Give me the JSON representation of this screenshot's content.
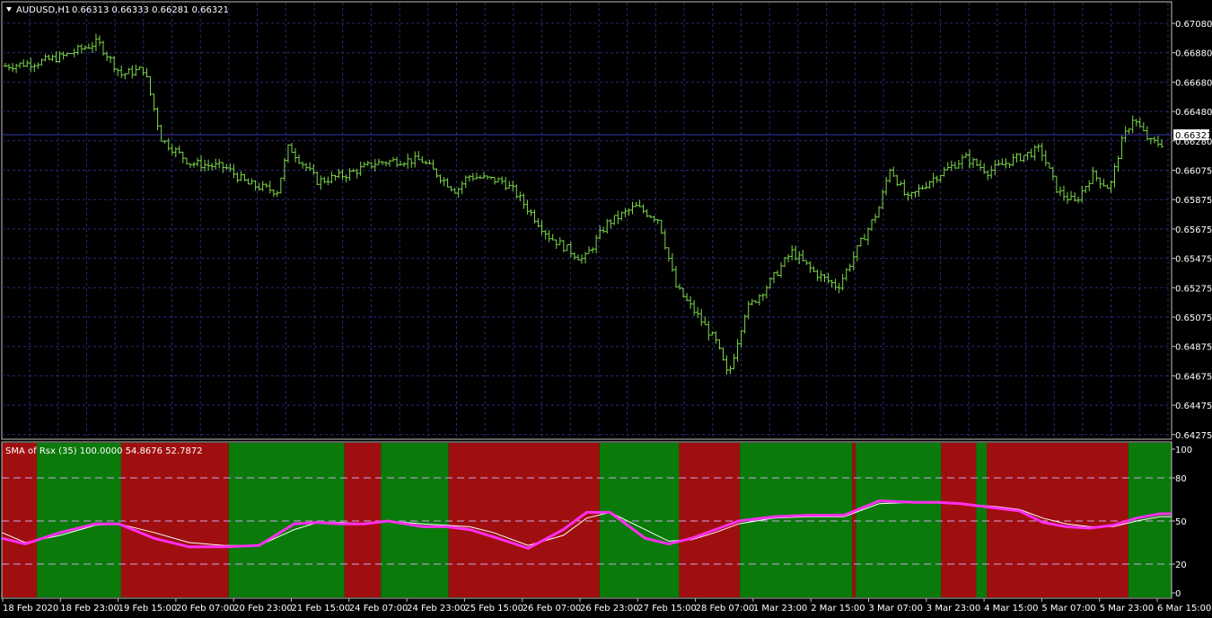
{
  "header": {
    "symbol_tf": "AUDUSD,H1",
    "ohlc": "0.66313 0.66333 0.66281 0.66321"
  },
  "indicator": {
    "label": "SMA  of Rsx (35) 100.0000 54.8676 52.7872"
  },
  "price_axis": {
    "ticks": [
      "0.67080",
      "0.66880",
      "0.66680",
      "0.66480",
      "0.66280",
      "0.66075",
      "0.65875",
      "0.65675",
      "0.65475",
      "0.65275",
      "0.65075",
      "0.64875",
      "0.64675",
      "0.64475",
      "0.64275"
    ],
    "current_price": "0.66321"
  },
  "indicator_axis": {
    "ticks": [
      "100",
      "80",
      "50",
      "20",
      "0"
    ]
  },
  "time_axis": {
    "ticks": [
      "18 Feb 2020",
      "18 Feb 23:00",
      "19 Feb 15:00",
      "20 Feb 07:00",
      "20 Feb 23:00",
      "21 Feb 15:00",
      "24 Feb 07:00",
      "24 Feb 23:00",
      "25 Feb 15:00",
      "26 Feb 07:00",
      "26 Feb 23:00",
      "27 Feb 15:00",
      "28 Feb 07:00",
      "1 Mar 23:00",
      "2 Mar 15:00",
      "3 Mar 07:00",
      "3 Mar 23:00",
      "4 Mar 15:00",
      "5 Mar 07:00",
      "5 Mar 23:00",
      "6 Mar 15:00"
    ]
  },
  "colors": {
    "background": "#000000",
    "grid": "#2a2a78",
    "bars": "#7cd84a",
    "axis_text": "#ffffff",
    "zone_bull": "#0a7a0a",
    "zone_bear": "#a00f0f",
    "rsx_line": "#ff2ef0",
    "signal_line": "#ffffff",
    "level_line": "#c9a8e8"
  },
  "chart_data": {
    "type": "line",
    "title": "AUDUSD,H1",
    "price_path": [
      [
        0,
        0.6687
      ],
      [
        0.03,
        0.669
      ],
      [
        0.05,
        0.6694
      ],
      [
        0.08,
        0.6704
      ],
      [
        0.1,
        0.6681
      ],
      [
        0.12,
        0.6685
      ],
      [
        0.135,
        0.6635
      ],
      [
        0.16,
        0.6618
      ],
      [
        0.19,
        0.6615
      ],
      [
        0.21,
        0.6603
      ],
      [
        0.235,
        0.6598
      ],
      [
        0.245,
        0.663
      ],
      [
        0.27,
        0.6605
      ],
      [
        0.295,
        0.661
      ],
      [
        0.32,
        0.6618
      ],
      [
        0.34,
        0.662
      ],
      [
        0.36,
        0.662
      ],
      [
        0.39,
        0.6598
      ],
      [
        0.4,
        0.6609
      ],
      [
        0.43,
        0.6605
      ],
      [
        0.44,
        0.6598
      ],
      [
        0.47,
        0.6566
      ],
      [
        0.5,
        0.6549
      ],
      [
        0.52,
        0.6575
      ],
      [
        0.545,
        0.6587
      ],
      [
        0.565,
        0.6578
      ],
      [
        0.58,
        0.653
      ],
      [
        0.6,
        0.6508
      ],
      [
        0.615,
        0.649
      ],
      [
        0.625,
        0.6466
      ],
      [
        0.64,
        0.6513
      ],
      [
        0.66,
        0.6532
      ],
      [
        0.68,
        0.6555
      ],
      [
        0.7,
        0.654
      ],
      [
        0.72,
        0.653
      ],
      [
        0.74,
        0.6562
      ],
      [
        0.755,
        0.6585
      ],
      [
        0.765,
        0.6615
      ],
      [
        0.78,
        0.6592
      ],
      [
        0.8,
        0.6606
      ],
      [
        0.83,
        0.6622
      ],
      [
        0.85,
        0.6612
      ],
      [
        0.87,
        0.662
      ],
      [
        0.895,
        0.6628
      ],
      [
        0.91,
        0.6598
      ],
      [
        0.925,
        0.659
      ],
      [
        0.94,
        0.661
      ],
      [
        0.955,
        0.66
      ],
      [
        0.965,
        0.6632
      ],
      [
        0.975,
        0.665
      ],
      [
        0.99,
        0.6633
      ],
      [
        1,
        0.6632
      ]
    ],
    "price_range": [
      0.64275,
      0.6718
    ],
    "rsx_series": {
      "x": [
        0,
        0.02,
        0.05,
        0.08,
        0.1,
        0.13,
        0.16,
        0.19,
        0.22,
        0.25,
        0.27,
        0.29,
        0.31,
        0.33,
        0.36,
        0.38,
        0.4,
        0.42,
        0.45,
        0.48,
        0.5,
        0.52,
        0.55,
        0.57,
        0.59,
        0.61,
        0.63,
        0.66,
        0.69,
        0.72,
        0.75,
        0.78,
        0.8,
        0.82,
        0.85,
        0.87,
        0.89,
        0.91,
        0.93,
        0.95,
        0.97,
        0.99,
        1
      ],
      "values": [
        38,
        34,
        42,
        48,
        48,
        38,
        32,
        32,
        33,
        48,
        49,
        48,
        48,
        50,
        46,
        46,
        44,
        39,
        31,
        44,
        56,
        56,
        38,
        34,
        38,
        44,
        50,
        53,
        54,
        54,
        64,
        63,
        63,
        62,
        59,
        57,
        49,
        46,
        45,
        47,
        52,
        55,
        55
      ]
    },
    "signal_series": {
      "x": [
        0,
        0.02,
        0.05,
        0.08,
        0.1,
        0.13,
        0.16,
        0.19,
        0.22,
        0.25,
        0.27,
        0.29,
        0.31,
        0.33,
        0.36,
        0.38,
        0.4,
        0.42,
        0.45,
        0.48,
        0.5,
        0.52,
        0.55,
        0.57,
        0.59,
        0.61,
        0.63,
        0.66,
        0.69,
        0.72,
        0.75,
        0.78,
        0.8,
        0.82,
        0.85,
        0.87,
        0.89,
        0.91,
        0.93,
        0.95,
        0.97,
        0.99,
        1
      ],
      "values": [
        42,
        35,
        40,
        47,
        48,
        42,
        35,
        33,
        33,
        44,
        49,
        49,
        48,
        50,
        48,
        47,
        46,
        42,
        33,
        40,
        52,
        56,
        44,
        36,
        37,
        42,
        48,
        52,
        53,
        53,
        62,
        63,
        63,
        62,
        60,
        58,
        52,
        48,
        46,
        46,
        50,
        53,
        53
      ]
    },
    "zones": [
      {
        "from": 0.0,
        "to": 0.03,
        "state": "bear"
      },
      {
        "from": 0.03,
        "to": 0.102,
        "state": "bull"
      },
      {
        "from": 0.102,
        "to": 0.194,
        "state": "bear"
      },
      {
        "from": 0.194,
        "to": 0.293,
        "state": "bull"
      },
      {
        "from": 0.293,
        "to": 0.324,
        "state": "bear"
      },
      {
        "from": 0.324,
        "to": 0.382,
        "state": "bull"
      },
      {
        "from": 0.382,
        "to": 0.511,
        "state": "bear"
      },
      {
        "from": 0.511,
        "to": 0.579,
        "state": "bull"
      },
      {
        "from": 0.579,
        "to": 0.631,
        "state": "bear"
      },
      {
        "from": 0.631,
        "to": 0.727,
        "state": "bull"
      },
      {
        "from": 0.727,
        "to": 0.73,
        "state": "bear"
      },
      {
        "from": 0.73,
        "to": 0.803,
        "state": "bull"
      },
      {
        "from": 0.803,
        "to": 0.833,
        "state": "bear"
      },
      {
        "from": 0.833,
        "to": 0.842,
        "state": "bull"
      },
      {
        "from": 0.842,
        "to": 0.963,
        "state": "bear"
      },
      {
        "from": 0.963,
        "to": 1.0,
        "state": "bull"
      }
    ],
    "indicator_levels": [
      80,
      50,
      20
    ],
    "indicator_range": [
      0,
      100
    ],
    "grid": true
  }
}
